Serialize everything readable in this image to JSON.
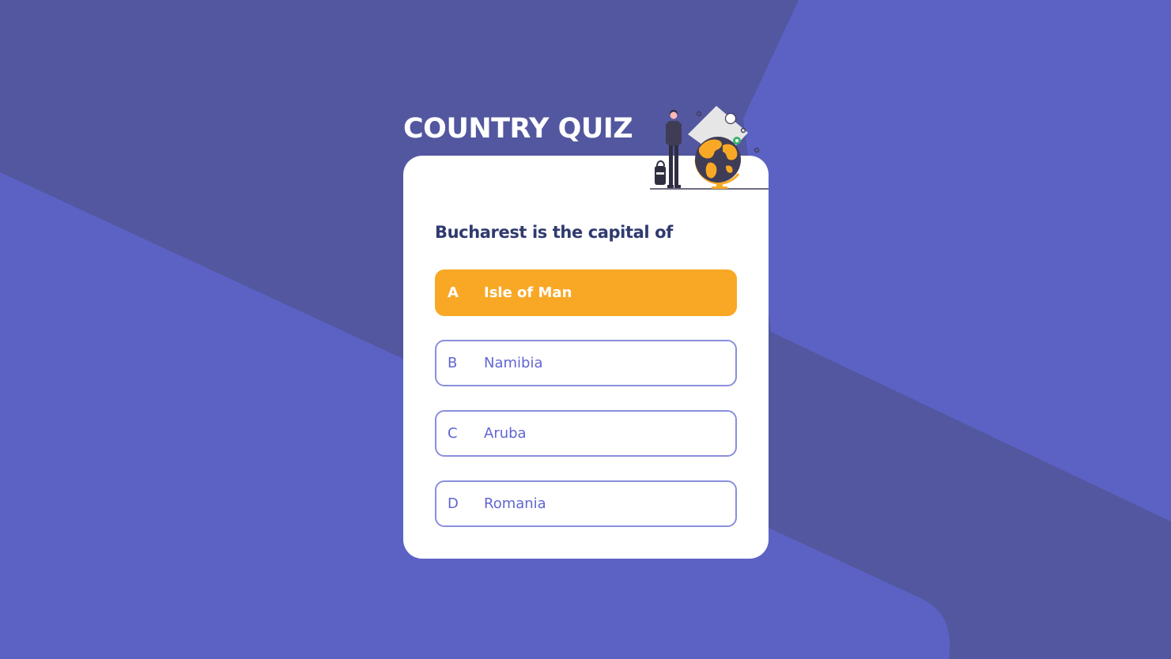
{
  "app": {
    "title": "COUNTRY QUIZ"
  },
  "illustration": {
    "icon": "traveler-globe-icon"
  },
  "quiz": {
    "question": "Bucharest is the capital of",
    "options": [
      {
        "letter": "A",
        "text": "Isle of Man",
        "selected": true
      },
      {
        "letter": "B",
        "text": "Namibia",
        "selected": false
      },
      {
        "letter": "C",
        "text": "Aruba",
        "selected": false
      },
      {
        "letter": "D",
        "text": "Romania",
        "selected": false
      }
    ]
  },
  "colors": {
    "background": "#5c62c4",
    "background_band": "#52579f",
    "card": "#ffffff",
    "title": "#ffffff",
    "question": "#2f3a6e",
    "option_border": "#8a8fdc",
    "option_text": "#6066d0",
    "selected": "#f9a826"
  }
}
